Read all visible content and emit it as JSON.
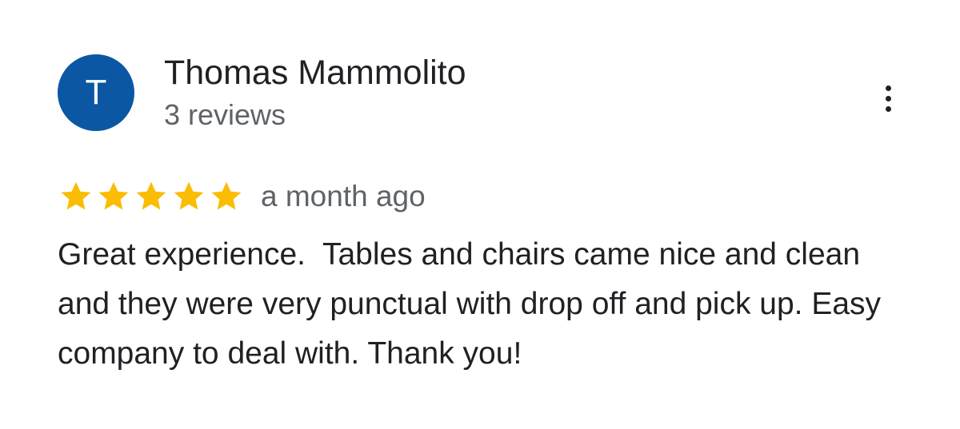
{
  "reviewer": {
    "avatar_letter": "T",
    "avatar_color": "#0b57a4",
    "name": "Thomas Mammolito",
    "review_count": "3 reviews"
  },
  "review": {
    "rating": 5,
    "max_rating": 5,
    "star_color": "#fbbc04",
    "date": "a month ago",
    "text": "Great experience.  Tables and chairs came nice and clean and they were very punctual with drop off and pick up. Easy company to deal with. Thank you!"
  },
  "menu": {
    "icon": "more-vert-icon"
  }
}
